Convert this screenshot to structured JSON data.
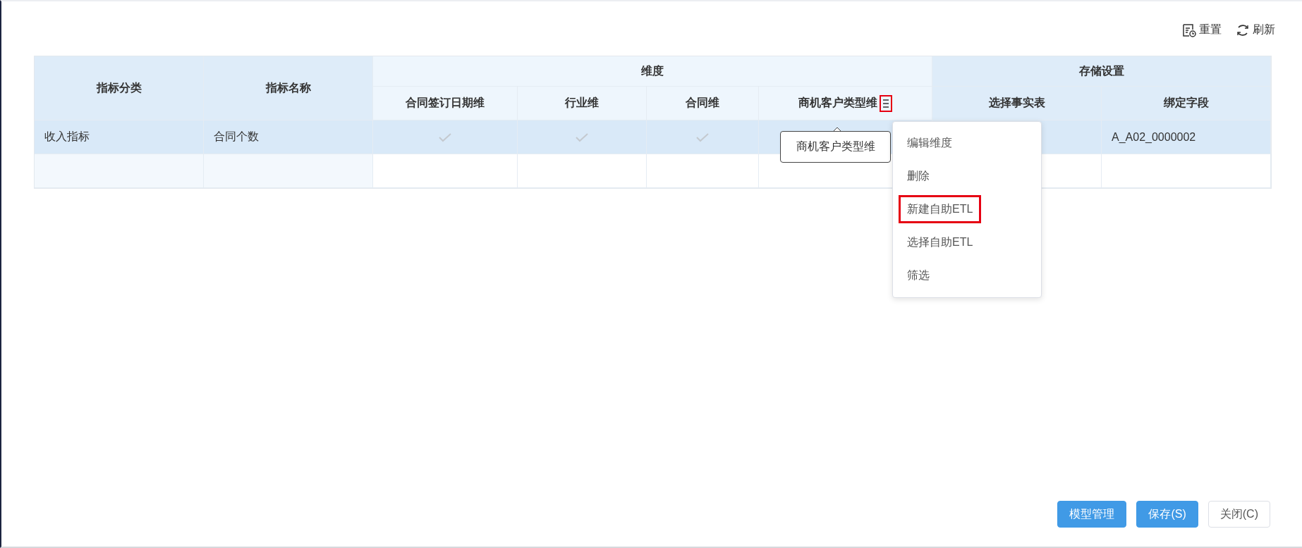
{
  "toolbar": [
    {
      "kind": "reset",
      "label": "重置"
    },
    {
      "kind": "refresh",
      "label": "刷新"
    }
  ],
  "table": {
    "fixed_columns": [
      "指标分类",
      "指标名称"
    ],
    "groups": [
      {
        "label": "维度",
        "columns": [
          {
            "label": "合同签订日期维"
          },
          {
            "label": "行业维"
          },
          {
            "label": "合同维"
          },
          {
            "label": "商机客户类型维",
            "menu_icon": true,
            "highlighted": true
          }
        ]
      },
      {
        "label": "存储设置",
        "columns": [
          {
            "label": "选择事实表"
          },
          {
            "label": "绑定字段"
          }
        ]
      }
    ],
    "rows": [
      {
        "selected": true,
        "cells": [
          {
            "kind": "text",
            "text": "收入指标"
          },
          {
            "kind": "text",
            "text": "合同个数"
          },
          {
            "kind": "check",
            "checked": true
          },
          {
            "kind": "check",
            "checked": true
          },
          {
            "kind": "check",
            "checked": true
          },
          {
            "kind": "empty"
          },
          {
            "kind": "empty"
          },
          {
            "kind": "text",
            "text": "A_A02_0000002"
          }
        ]
      },
      {
        "selected": false,
        "cells": [
          {
            "kind": "empty"
          },
          {
            "kind": "empty"
          },
          {
            "kind": "empty"
          },
          {
            "kind": "empty"
          },
          {
            "kind": "empty"
          },
          {
            "kind": "empty"
          },
          {
            "kind": "empty"
          },
          {
            "kind": "empty"
          }
        ]
      }
    ]
  },
  "tooltip": {
    "text": "商机客户类型维"
  },
  "menu": {
    "items": [
      {
        "label": "编辑维度",
        "highlighted": false
      },
      {
        "label": "删除",
        "highlighted": false
      },
      {
        "label": "新建自助ETL",
        "highlighted": true
      },
      {
        "label": "选择自助ETL",
        "highlighted": false
      },
      {
        "label": "筛选",
        "highlighted": false
      }
    ]
  },
  "buttons": [
    {
      "label": "模型管理",
      "primary": true
    },
    {
      "label": "保存(S)",
      "primary": true
    },
    {
      "label": "关闭(C)",
      "primary": false
    }
  ]
}
